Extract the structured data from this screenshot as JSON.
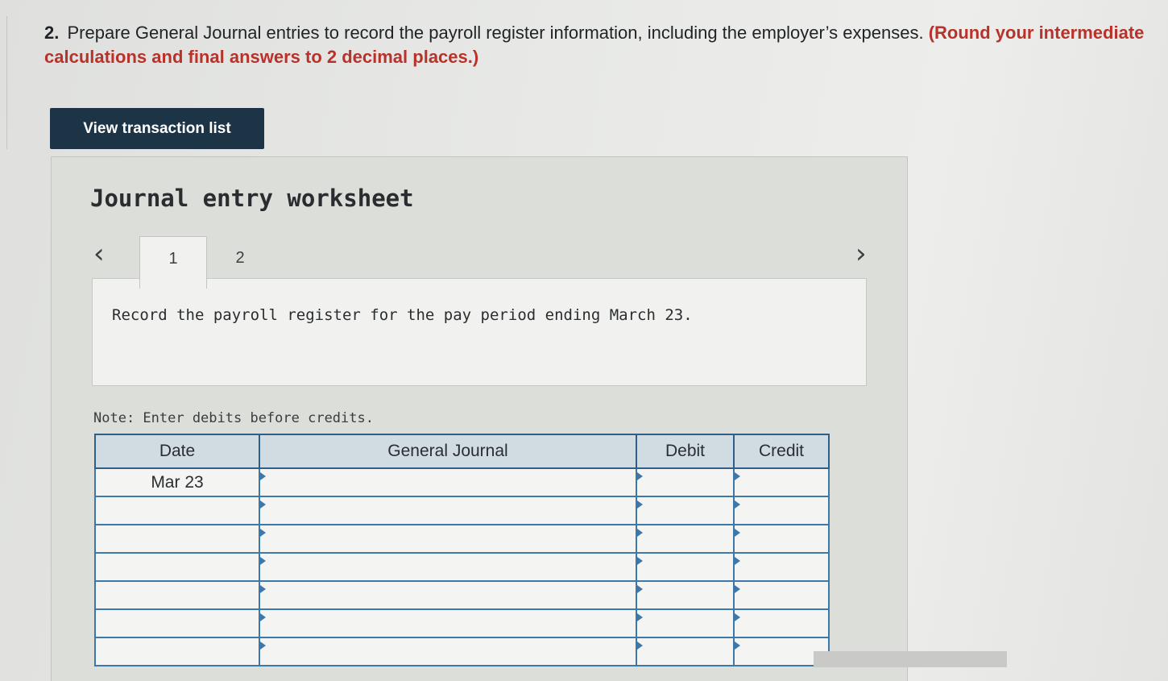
{
  "question": {
    "number": "2.",
    "text": "Prepare General Journal entries to record the payroll register information, including the employer’s expenses.",
    "rounding_note": "(Round your intermediate calculations and final answers to 2 decimal places.)"
  },
  "view_button": {
    "label": "View transaction list"
  },
  "worksheet": {
    "title": "Journal entry worksheet",
    "tabs": [
      {
        "label": "1",
        "active": true
      },
      {
        "label": "2",
        "active": false
      }
    ],
    "instruction": "Record the payroll register for the pay period ending March 23.",
    "note": "Note: Enter debits before credits."
  },
  "journal": {
    "headers": {
      "date": "Date",
      "general_journal": "General Journal",
      "debit": "Debit",
      "credit": "Credit"
    },
    "rows": [
      {
        "date": "Mar 23",
        "account": "",
        "debit": "",
        "credit": ""
      },
      {
        "date": "",
        "account": "",
        "debit": "",
        "credit": ""
      },
      {
        "date": "",
        "account": "",
        "debit": "",
        "credit": ""
      },
      {
        "date": "",
        "account": "",
        "debit": "",
        "credit": ""
      },
      {
        "date": "",
        "account": "",
        "debit": "",
        "credit": ""
      },
      {
        "date": "",
        "account": "",
        "debit": "",
        "credit": ""
      },
      {
        "date": "",
        "account": "",
        "debit": "",
        "credit": ""
      }
    ]
  },
  "icons": {
    "prev": "chevron-left-icon",
    "next": "chevron-right-icon"
  },
  "colors": {
    "button_bg": "#1d3446",
    "rounding_note": "#b8322c",
    "table_border": "#3d78a9",
    "header_bg": "#d1dbe2"
  }
}
